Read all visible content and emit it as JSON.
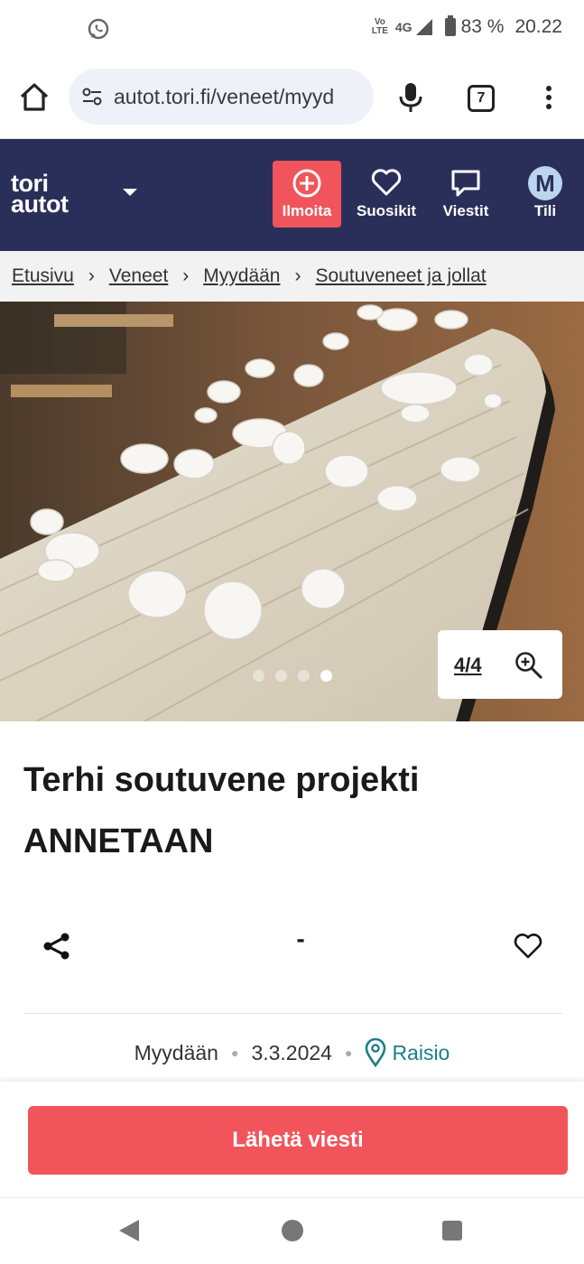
{
  "status_bar": {
    "network_label": "4G",
    "volte_label": "Vo LTE",
    "battery": "83 %",
    "time": "20.22"
  },
  "browser": {
    "url": "autot.tori.fi/veneet/myyd",
    "tab_count": "7"
  },
  "header": {
    "logo_line1": "tori",
    "logo_line2": "autot",
    "nav": {
      "post": "Ilmoita",
      "favorites": "Suosikit",
      "messages": "Viestit",
      "account": "Tili",
      "avatar_initial": "M"
    },
    "colors": {
      "navy": "#2a2f5a",
      "accent": "#f2545b"
    }
  },
  "breadcrumb": [
    "Etusivu",
    "Veneet",
    "Myydään",
    "Soutuveneet ja jollat"
  ],
  "gallery": {
    "counter": "4/4",
    "image_total": 4,
    "image_current": 4
  },
  "listing": {
    "title": "Terhi soutuvene projekti ANNETAAN",
    "price": "-",
    "type": "Myydään",
    "date": "3.3.2024",
    "location": "Raisio"
  },
  "cta": {
    "label": "Lähetä viesti"
  }
}
